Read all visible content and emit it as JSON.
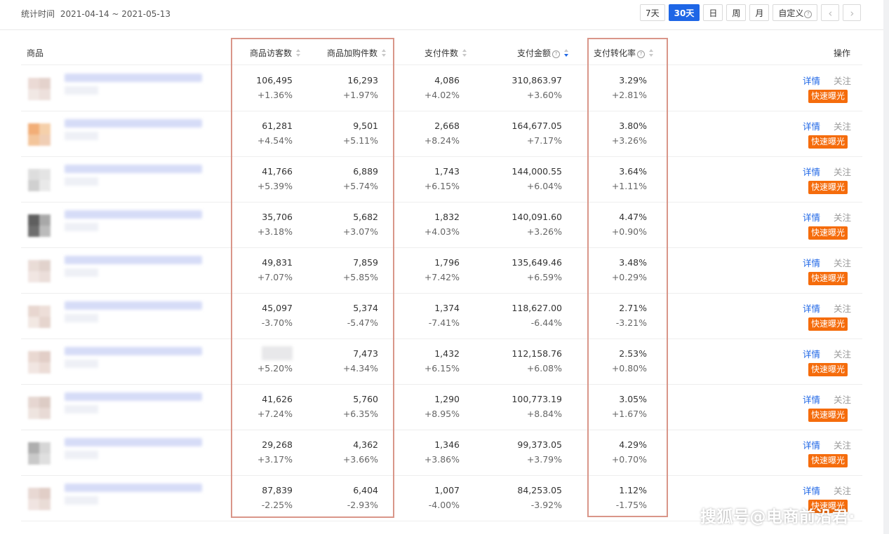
{
  "header": {
    "date_label": "统计时间",
    "date_value": "2021-04-14 ~ 2021-05-13",
    "periods": [
      {
        "label": "7天",
        "active": false
      },
      {
        "label": "30天",
        "active": true
      },
      {
        "label": "日",
        "active": false
      },
      {
        "label": "周",
        "active": false
      },
      {
        "label": "月",
        "active": false
      },
      {
        "label": "自定义",
        "active": false
      }
    ],
    "prev_icon": "chevron-left-icon",
    "next_icon": "chevron-right-icon"
  },
  "table": {
    "columns": {
      "product": "商品",
      "visitors": "商品访客数",
      "cart": "商品加购件数",
      "pay_items": "支付件数",
      "pay_amount": "支付金额",
      "conversion": "支付转化率",
      "actions": "操作"
    },
    "action_labels": {
      "detail": "详情",
      "follow": "关注",
      "exposure": "快速曝光"
    },
    "rows": [
      {
        "visitors": "106,495",
        "visitors_chg": "+1.36%",
        "cart": "16,293",
        "cart_chg": "+1.97%",
        "pay_items": "4,086",
        "pay_items_chg": "+4.02%",
        "pay_amount": "310,863.97",
        "pay_amount_chg": "+3.60%",
        "conversion": "3.29%",
        "conversion_chg": "+2.81%"
      },
      {
        "visitors": "61,281",
        "visitors_chg": "+4.54%",
        "cart": "9,501",
        "cart_chg": "+5.11%",
        "pay_items": "2,668",
        "pay_items_chg": "+8.24%",
        "pay_amount": "164,677.05",
        "pay_amount_chg": "+7.17%",
        "conversion": "3.80%",
        "conversion_chg": "+3.26%"
      },
      {
        "visitors": "41,766",
        "visitors_chg": "+5.39%",
        "cart": "6,889",
        "cart_chg": "+5.74%",
        "pay_items": "1,743",
        "pay_items_chg": "+6.15%",
        "pay_amount": "144,000.55",
        "pay_amount_chg": "+6.04%",
        "conversion": "3.64%",
        "conversion_chg": "+1.11%"
      },
      {
        "visitors": "35,706",
        "visitors_chg": "+3.18%",
        "cart": "5,682",
        "cart_chg": "+3.07%",
        "pay_items": "1,832",
        "pay_items_chg": "+4.03%",
        "pay_amount": "140,091.60",
        "pay_amount_chg": "+3.26%",
        "conversion": "4.47%",
        "conversion_chg": "+0.90%"
      },
      {
        "visitors": "49,831",
        "visitors_chg": "+7.07%",
        "cart": "7,859",
        "cart_chg": "+5.85%",
        "pay_items": "1,796",
        "pay_items_chg": "+7.42%",
        "pay_amount": "135,649.46",
        "pay_amount_chg": "+6.59%",
        "conversion": "3.48%",
        "conversion_chg": "+0.29%"
      },
      {
        "visitors": "45,097",
        "visitors_chg": "-3.70%",
        "cart": "5,374",
        "cart_chg": "-5.47%",
        "pay_items": "1,374",
        "pay_items_chg": "-7.41%",
        "pay_amount": "118,627.00",
        "pay_amount_chg": "-6.44%",
        "conversion": "2.71%",
        "conversion_chg": "-3.21%"
      },
      {
        "visitors": "",
        "visitors_chg": "+5.20%",
        "cart": "7,473",
        "cart_chg": "+4.34%",
        "pay_items": "1,432",
        "pay_items_chg": "+6.15%",
        "pay_amount": "112,158.76",
        "pay_amount_chg": "+6.08%",
        "conversion": "2.53%",
        "conversion_chg": "+0.80%"
      },
      {
        "visitors": "41,626",
        "visitors_chg": "+7.24%",
        "cart": "5,760",
        "cart_chg": "+6.35%",
        "pay_items": "1,290",
        "pay_items_chg": "+8.95%",
        "pay_amount": "100,773.19",
        "pay_amount_chg": "+8.84%",
        "conversion": "3.05%",
        "conversion_chg": "+1.67%"
      },
      {
        "visitors": "29,268",
        "visitors_chg": "+3.17%",
        "cart": "4,362",
        "cart_chg": "+3.66%",
        "pay_items": "1,346",
        "pay_items_chg": "+3.86%",
        "pay_amount": "99,373.05",
        "pay_amount_chg": "+3.79%",
        "conversion": "4.29%",
        "conversion_chg": "+0.70%"
      },
      {
        "visitors": "87,839",
        "visitors_chg": "-2.25%",
        "cart": "6,404",
        "cart_chg": "-2.93%",
        "pay_items": "1,007",
        "pay_items_chg": "-4.00%",
        "pay_amount": "84,253.05",
        "pay_amount_chg": "-3.92%",
        "conversion": "1.12%",
        "conversion_chg": "-1.75%"
      }
    ]
  },
  "watermark": "搜狐号@电商前沿君·",
  "colors": {
    "accent": "#1e66e6",
    "exposure_button": "#f56c0c",
    "highlight_box": "#d99689"
  }
}
